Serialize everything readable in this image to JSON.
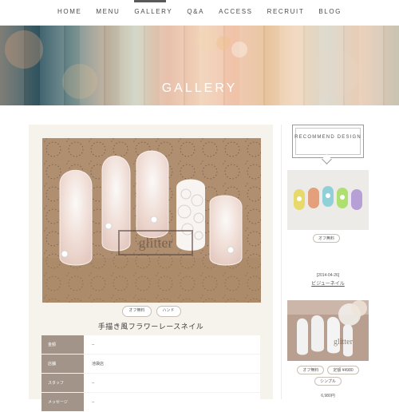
{
  "nav": {
    "items": [
      "HOME",
      "MENU",
      "GALLERY",
      "Q&A",
      "ACCESS",
      "RECRUIT",
      "BLOG"
    ],
    "active": "GALLERY"
  },
  "hero": {
    "title": "GALLERY"
  },
  "main": {
    "photo": {
      "watermark_text": "glitter"
    },
    "tags": [
      "オフ無料",
      "ハンド"
    ],
    "title": "手描き風フラワーレースネイル",
    "info": [
      {
        "label": "金額",
        "value": "--"
      },
      {
        "label": "店舗",
        "value": "池袋店"
      },
      {
        "label": "スタッフ",
        "value": "--"
      },
      {
        "label": "メッセージ",
        "value": "--"
      }
    ]
  },
  "sidebar": {
    "recommend_label": "RECOMMEND DESIGN",
    "items": [
      {
        "tags": [
          "オフ無料"
        ],
        "date": "[2014-04-26]",
        "name": "ビジューネイル"
      },
      {
        "tags": [
          "オフ無料",
          "定額 ¥4980",
          "シンプル"
        ],
        "price": "6,980円"
      }
    ]
  },
  "colors": {
    "nav_active": "#5a5a5a",
    "card_bg": "#f6f2ec",
    "label_bg": "#a29488"
  }
}
